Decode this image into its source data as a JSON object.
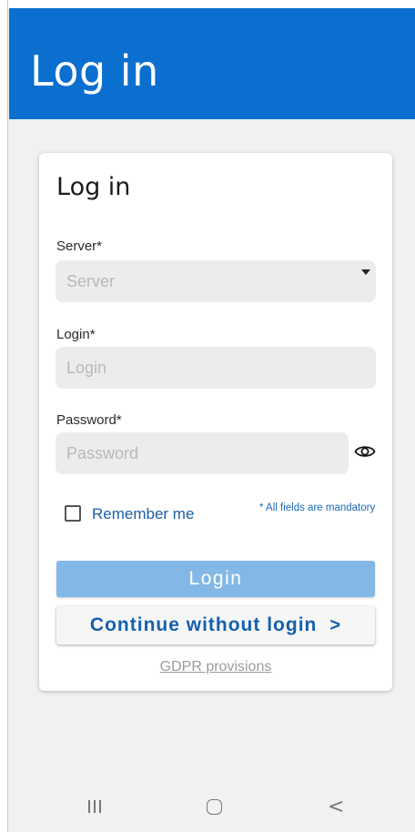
{
  "header": {
    "title": "Log in"
  },
  "card": {
    "title": "Log in",
    "server": {
      "label": "Server*",
      "placeholder": "Server"
    },
    "login": {
      "label": "Login*",
      "placeholder": "Login"
    },
    "password": {
      "label": "Password*",
      "placeholder": "Password"
    },
    "remember_label": "Remember me",
    "mandatory_note": "* All fields are mandatory",
    "login_button": "Login",
    "continue_button": "Continue without login",
    "continue_chevron": ">",
    "gdpr_link": "GDPR provisions"
  },
  "navbar": {
    "back_glyph": "<"
  },
  "colors": {
    "brand": "#0a6fcf",
    "accent": "#1560ad",
    "login_button": "#83b8e6"
  }
}
